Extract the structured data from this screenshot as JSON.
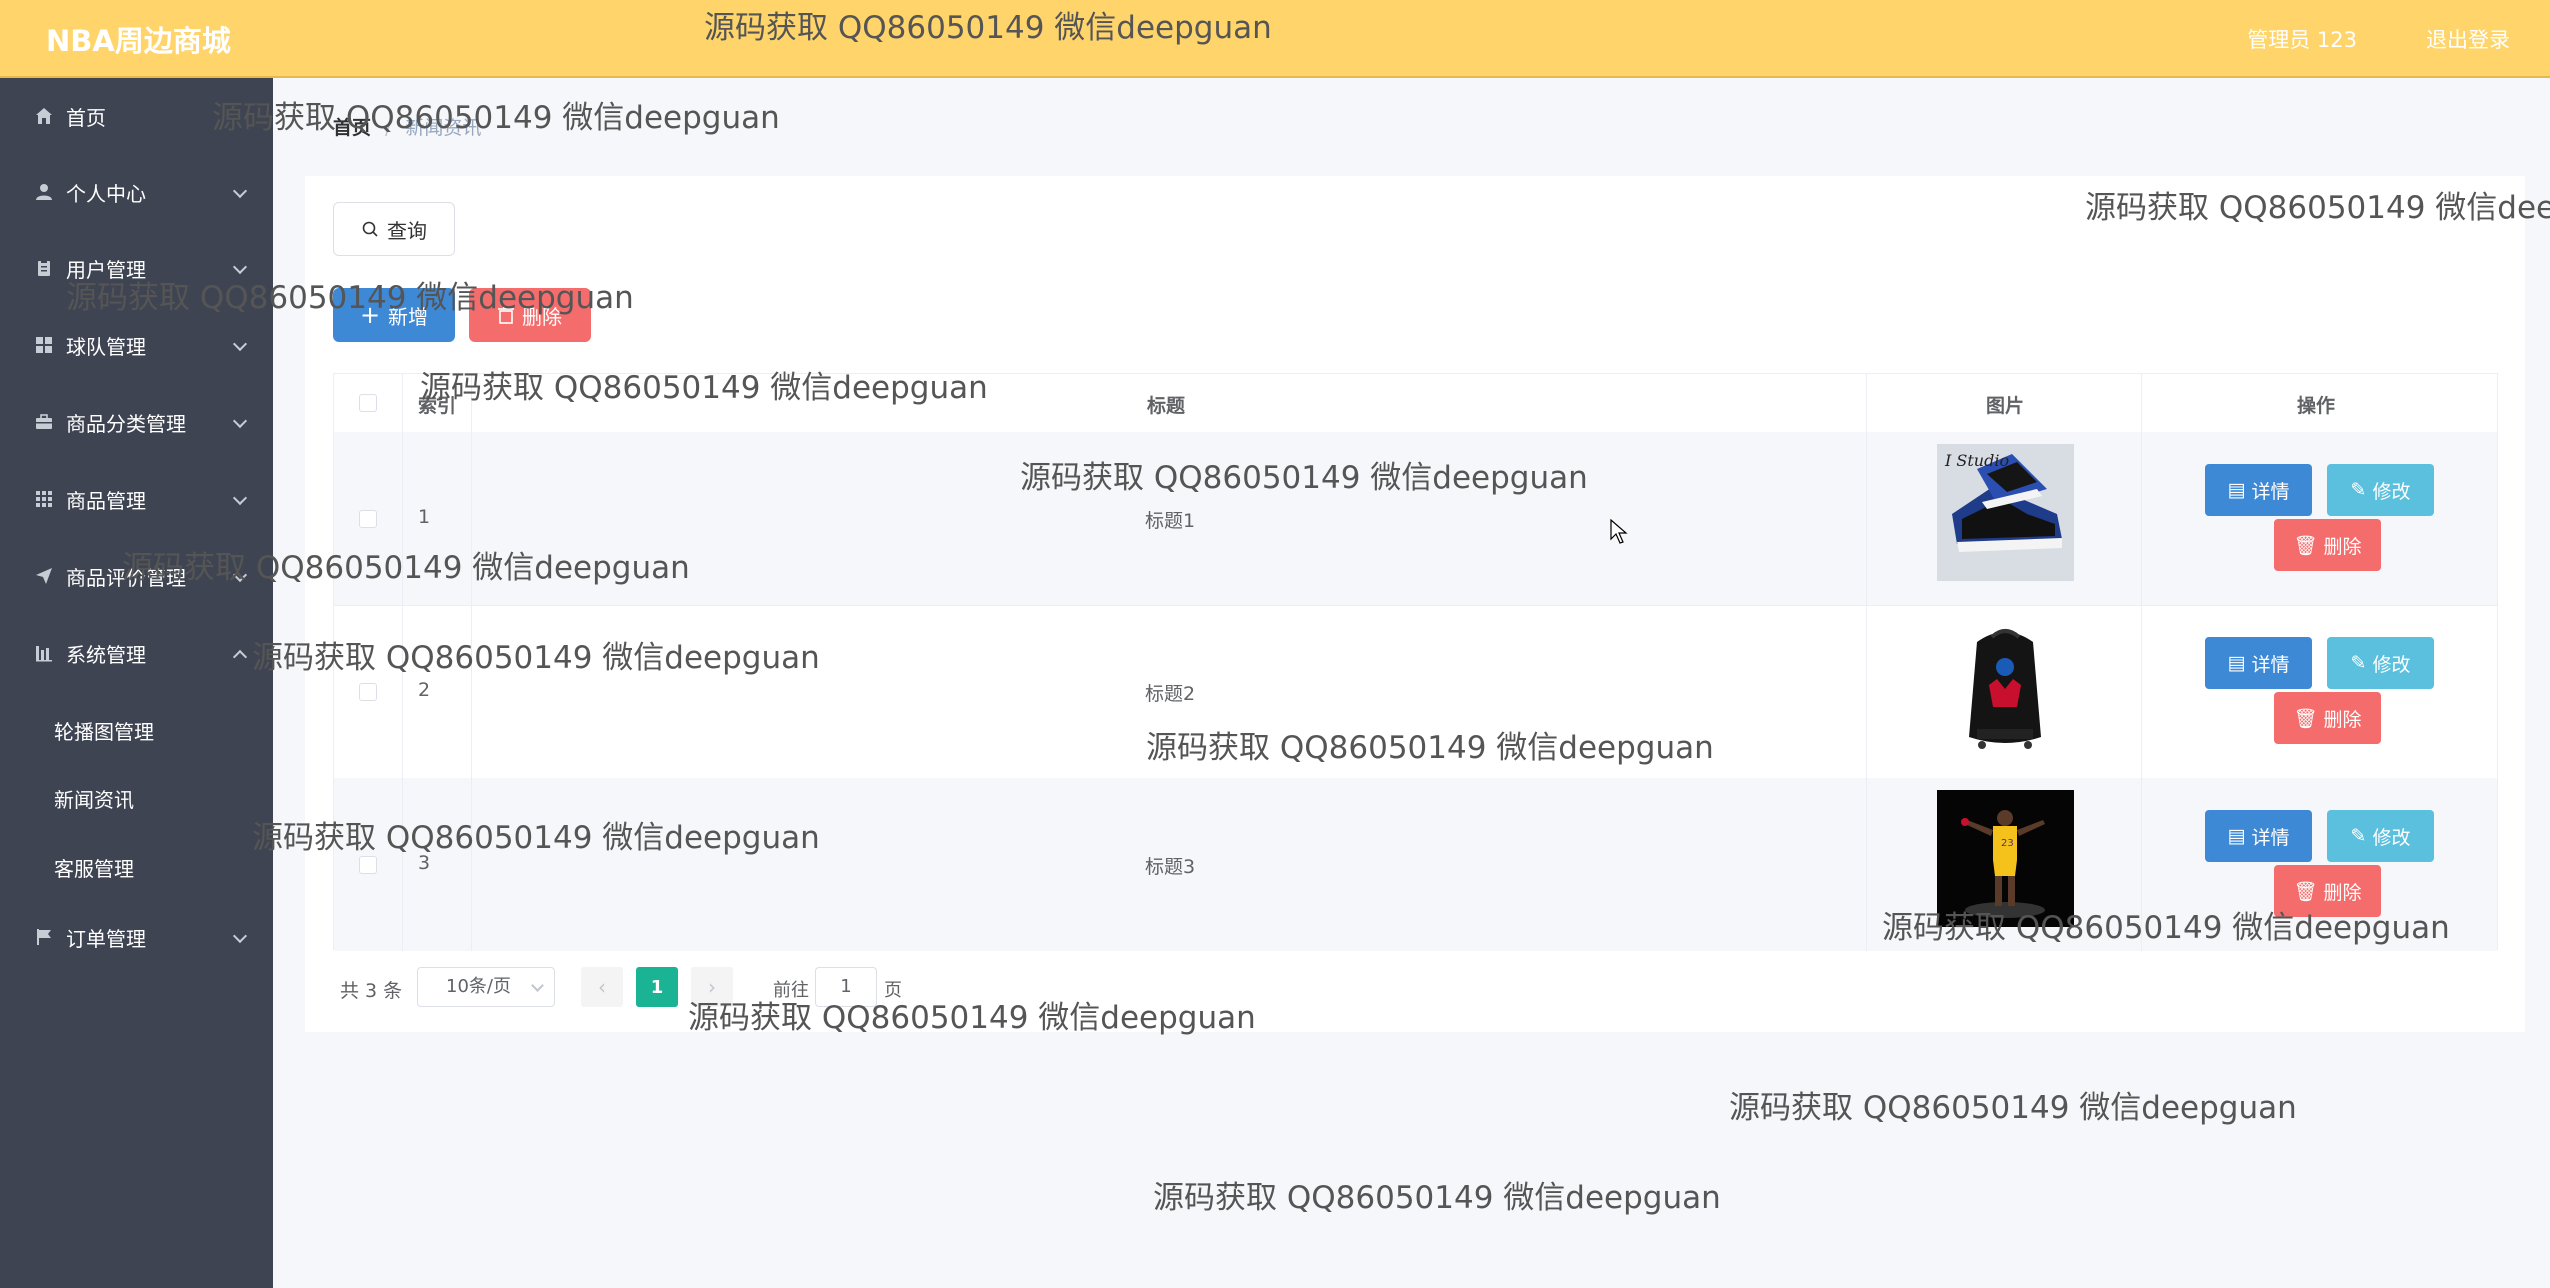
{
  "header": {
    "brand": "NBA周边商城",
    "user": "管理员 123",
    "logout": "退出登录"
  },
  "sidebar": {
    "items": [
      {
        "label": "首页",
        "icon": "home-icon"
      },
      {
        "label": "个人中心",
        "icon": "user-icon"
      },
      {
        "label": "用户管理",
        "icon": "clipboard-icon"
      },
      {
        "label": "球队管理",
        "icon": "grid-icon"
      },
      {
        "label": "商品分类管理",
        "icon": "briefcase-icon"
      },
      {
        "label": "商品管理",
        "icon": "apps-icon"
      },
      {
        "label": "商品评价管理",
        "icon": "send-icon"
      },
      {
        "label": "系统管理",
        "icon": "chart-bar-icon"
      },
      {
        "label": "订单管理",
        "icon": "flag-icon"
      }
    ],
    "sub_items": [
      "轮播图管理",
      "新闻资讯",
      "客服管理"
    ]
  },
  "breadcrumb": {
    "home": "首页",
    "separator": "/",
    "current": "新闻资讯"
  },
  "toolbar": {
    "query": "查询",
    "add": "新增",
    "delete": "删除"
  },
  "table": {
    "headers": {
      "index": "索引",
      "title": "标题",
      "image": "图片",
      "actions": "操作"
    },
    "rows": [
      {
        "index": "1",
        "title": "标题1",
        "image": "sneaker"
      },
      {
        "index": "2",
        "title": "标题2",
        "image": "backpack"
      },
      {
        "index": "3",
        "title": "标题3",
        "image": "player-figure"
      }
    ],
    "actions": {
      "detail": "详情",
      "edit": "修改",
      "delete": "删除"
    }
  },
  "pagination": {
    "total": "共 3 条",
    "page_size": "10条/页",
    "current_page": "1",
    "goto_label": "前往",
    "goto_value": "1",
    "page_label": "页"
  },
  "watermark": "源码获取 QQ86050149 微信deepguan",
  "colors": {
    "header": "#ffd56b",
    "sidebar": "#3e4452",
    "primary": "#3e89d6",
    "danger": "#f56c6c",
    "info": "#5bc0de",
    "page_active": "#1ab394"
  }
}
